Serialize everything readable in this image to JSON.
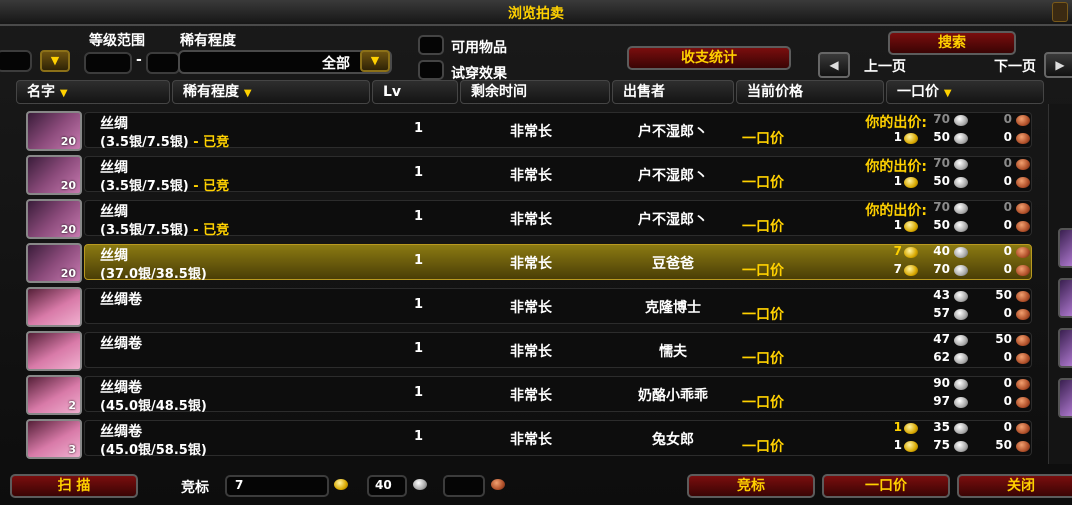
{
  "window": {
    "title": "浏览拍卖"
  },
  "filters": {
    "level_range_label": "等级范围",
    "rarity_label": "稀有程度",
    "rarity_value": "全部",
    "usable_label": "可用物品",
    "tryon_label": "试穿效果",
    "dash": "-"
  },
  "buttons": {
    "search": "搜索",
    "stats": "收支统计",
    "prev_page": "上一页",
    "next_page": "下一页",
    "scan": "扫 描",
    "bid": "竞标",
    "buyout": "一口价",
    "close": "关闭"
  },
  "columns": {
    "name": "名字",
    "rarity": "稀有程度",
    "lv": "Lv",
    "time_left": "剩余时间",
    "seller": "出售者",
    "current_price": "当前价格",
    "buyout": "一口价"
  },
  "rows": [
    {
      "name": "丝绸",
      "stack": "20",
      "sub": "(3.5银/7.5银)",
      "sub_status": " - 已竞",
      "lv": "1",
      "time": "非常长",
      "seller": "户不湿郎丶",
      "buyout_label": "一口价",
      "your_bid_label": "你的出价:",
      "bid": {
        "g": "",
        "s": "70",
        "c": "0"
      },
      "buy": {
        "g": "1",
        "s": "50",
        "c": "0"
      },
      "bid_dim": true,
      "selected": false,
      "icon": "silk-cloth-icon"
    },
    {
      "name": "丝绸",
      "stack": "20",
      "sub": "(3.5银/7.5银)",
      "sub_status": " - 已竞",
      "lv": "1",
      "time": "非常长",
      "seller": "户不湿郎丶",
      "buyout_label": "一口价",
      "your_bid_label": "你的出价:",
      "bid": {
        "g": "",
        "s": "70",
        "c": "0"
      },
      "buy": {
        "g": "1",
        "s": "50",
        "c": "0"
      },
      "bid_dim": true,
      "selected": false,
      "icon": "silk-cloth-icon"
    },
    {
      "name": "丝绸",
      "stack": "20",
      "sub": "(3.5银/7.5银)",
      "sub_status": " - 已竞",
      "lv": "1",
      "time": "非常长",
      "seller": "户不湿郎丶",
      "buyout_label": "一口价",
      "your_bid_label": "你的出价:",
      "bid": {
        "g": "",
        "s": "70",
        "c": "0"
      },
      "buy": {
        "g": "1",
        "s": "50",
        "c": "0"
      },
      "bid_dim": true,
      "selected": false,
      "icon": "silk-cloth-icon"
    },
    {
      "name": "丝绸",
      "stack": "20",
      "sub": "(37.0银/38.5银)",
      "sub_status": "",
      "lv": "1",
      "time": "非常长",
      "seller": "豆爸爸",
      "buyout_label": "一口价",
      "your_bid_label": "",
      "bid": {
        "g": "7",
        "s": "40",
        "c": "0"
      },
      "buy": {
        "g": "7",
        "s": "70",
        "c": "0"
      },
      "bid_dim": false,
      "selected": true,
      "icon": "silk-cloth-icon"
    },
    {
      "name": "丝绸卷",
      "stack": "",
      "sub": "",
      "sub_status": "",
      "lv": "1",
      "time": "非常长",
      "seller": "克隆博士",
      "buyout_label": "一口价",
      "your_bid_label": "",
      "bid": {
        "g": "",
        "s": "43",
        "c": "50"
      },
      "buy": {
        "g": "",
        "s": "57",
        "c": "0"
      },
      "bid_dim": false,
      "selected": false,
      "icon": "bolt-of-silk-icon"
    },
    {
      "name": "丝绸卷",
      "stack": "",
      "sub": "",
      "sub_status": "",
      "lv": "1",
      "time": "非常长",
      "seller": "懦夫",
      "buyout_label": "一口价",
      "your_bid_label": "",
      "bid": {
        "g": "",
        "s": "47",
        "c": "50"
      },
      "buy": {
        "g": "",
        "s": "62",
        "c": "0"
      },
      "bid_dim": false,
      "selected": false,
      "icon": "bolt-of-silk-icon"
    },
    {
      "name": "丝绸卷",
      "stack": "2",
      "sub": "(45.0银/48.5银)",
      "sub_status": "",
      "lv": "1",
      "time": "非常长",
      "seller": "奶酪小乖乖",
      "buyout_label": "一口价",
      "your_bid_label": "",
      "bid": {
        "g": "",
        "s": "90",
        "c": "0"
      },
      "buy": {
        "g": "",
        "s": "97",
        "c": "0"
      },
      "bid_dim": false,
      "selected": false,
      "icon": "bolt-of-silk-icon"
    },
    {
      "name": "丝绸卷",
      "stack": "3",
      "sub": "(45.0银/58.5银)",
      "sub_status": "",
      "lv": "1",
      "time": "非常长",
      "seller": "兔女郎",
      "buyout_label": "一口价",
      "your_bid_label": "",
      "bid": {
        "g": "1",
        "s": "35",
        "c": "0"
      },
      "buy": {
        "g": "1",
        "s": "75",
        "c": "50"
      },
      "bid_dim": false,
      "selected": false,
      "icon": "bolt-of-silk-icon"
    }
  ],
  "bottom": {
    "bid_label": "竞标",
    "bid_amount": "7",
    "silver": "40",
    "copper": ""
  },
  "colors": {
    "accent": "#ffd100",
    "button_red": "#7a0e0e",
    "selected_row": "#8b7a12"
  }
}
